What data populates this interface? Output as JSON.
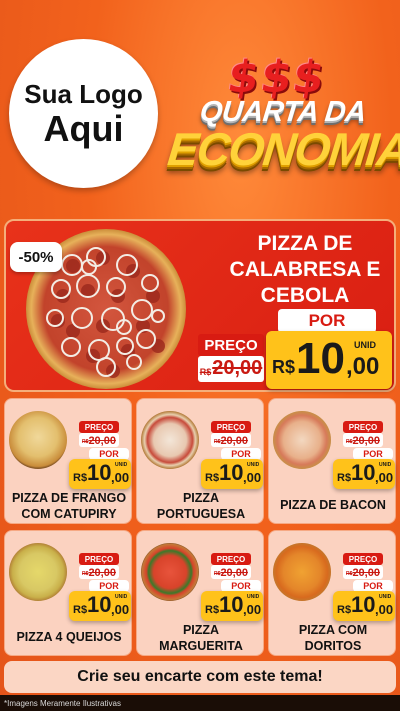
{
  "logo": {
    "line1": "Sua Logo",
    "line2": "Aqui"
  },
  "promo": {
    "dollars": [
      "$",
      "$",
      "$"
    ],
    "line1": "QUARTA DA",
    "line2": "ECONOMIA"
  },
  "colors": {
    "background": "#f2621c",
    "hero_red": "#d91e12",
    "price_yellow": "#ffc21a",
    "card_bg": "#fbd2c0"
  },
  "hero": {
    "discount": "-50%",
    "name_lines": [
      "PIZZA DE",
      "CALABRESA E",
      "CEBOLA"
    ],
    "preco_label": "PRECO_PLACEHOLDER",
    "old_currency": "R$",
    "old_price": "20,00",
    "por_label": "POR",
    "currency": "R$",
    "price_int": "10",
    "price_cents": ",00",
    "unid_label": "UNID"
  },
  "products": [
    {
      "name_lines": [
        "PIZZA DE FRANGO",
        "COM CATUPIRY"
      ],
      "preco_label": "PREÇO",
      "old_currency": "R$",
      "old_price": "20,00",
      "por_label": "POR",
      "currency": "R$",
      "price_int": "10",
      "price_cents": ",00",
      "unid_label": "UNID",
      "icon": "pizza-frango-icon"
    },
    {
      "name_lines": [
        "PIZZA",
        "PORTUGUESA"
      ],
      "preco_label": "PREÇO",
      "old_currency": "R$",
      "old_price": "20,00",
      "por_label": "POR",
      "currency": "R$",
      "price_int": "10",
      "price_cents": ",00",
      "unid_label": "UNID",
      "icon": "pizza-portuguesa-icon"
    },
    {
      "name_lines": [
        "PIZZA DE BACON"
      ],
      "preco_label": "PREÇO",
      "old_currency": "R$",
      "old_price": "20,00",
      "por_label": "POR",
      "currency": "R$",
      "price_int": "10",
      "price_cents": ",00",
      "unid_label": "UNID",
      "icon": "pizza-bacon-icon"
    },
    {
      "name_lines": [
        "PIZZA 4 QUEIJOS"
      ],
      "preco_label": "PREÇO",
      "old_currency": "R$",
      "old_price": "20,00",
      "por_label": "POR",
      "currency": "R$",
      "price_int": "10",
      "price_cents": ",00",
      "unid_label": "UNID",
      "icon": "pizza-4-queijos-icon"
    },
    {
      "name_lines": [
        "PIZZA",
        "MARGUERITA"
      ],
      "preco_label": "PREÇO",
      "old_currency": "R$",
      "old_price": "20,00",
      "por_label": "POR",
      "currency": "R$",
      "price_int": "10",
      "price_cents": ",00",
      "unid_label": "UNID",
      "icon": "pizza-marguerita-icon"
    },
    {
      "name_lines": [
        "PIZZA COM",
        "DORITOS"
      ],
      "preco_label": "PREÇO",
      "old_currency": "R$",
      "old_price": "20,00",
      "por_label": "POR",
      "currency": "R$",
      "price_int": "10",
      "price_cents": ",00",
      "unid_label": "UNID",
      "icon": "pizza-doritos-icon"
    }
  ],
  "cta": "Crie seu encarte com este tema!",
  "footer": "*Imagens Meramente Ilustrativas"
}
